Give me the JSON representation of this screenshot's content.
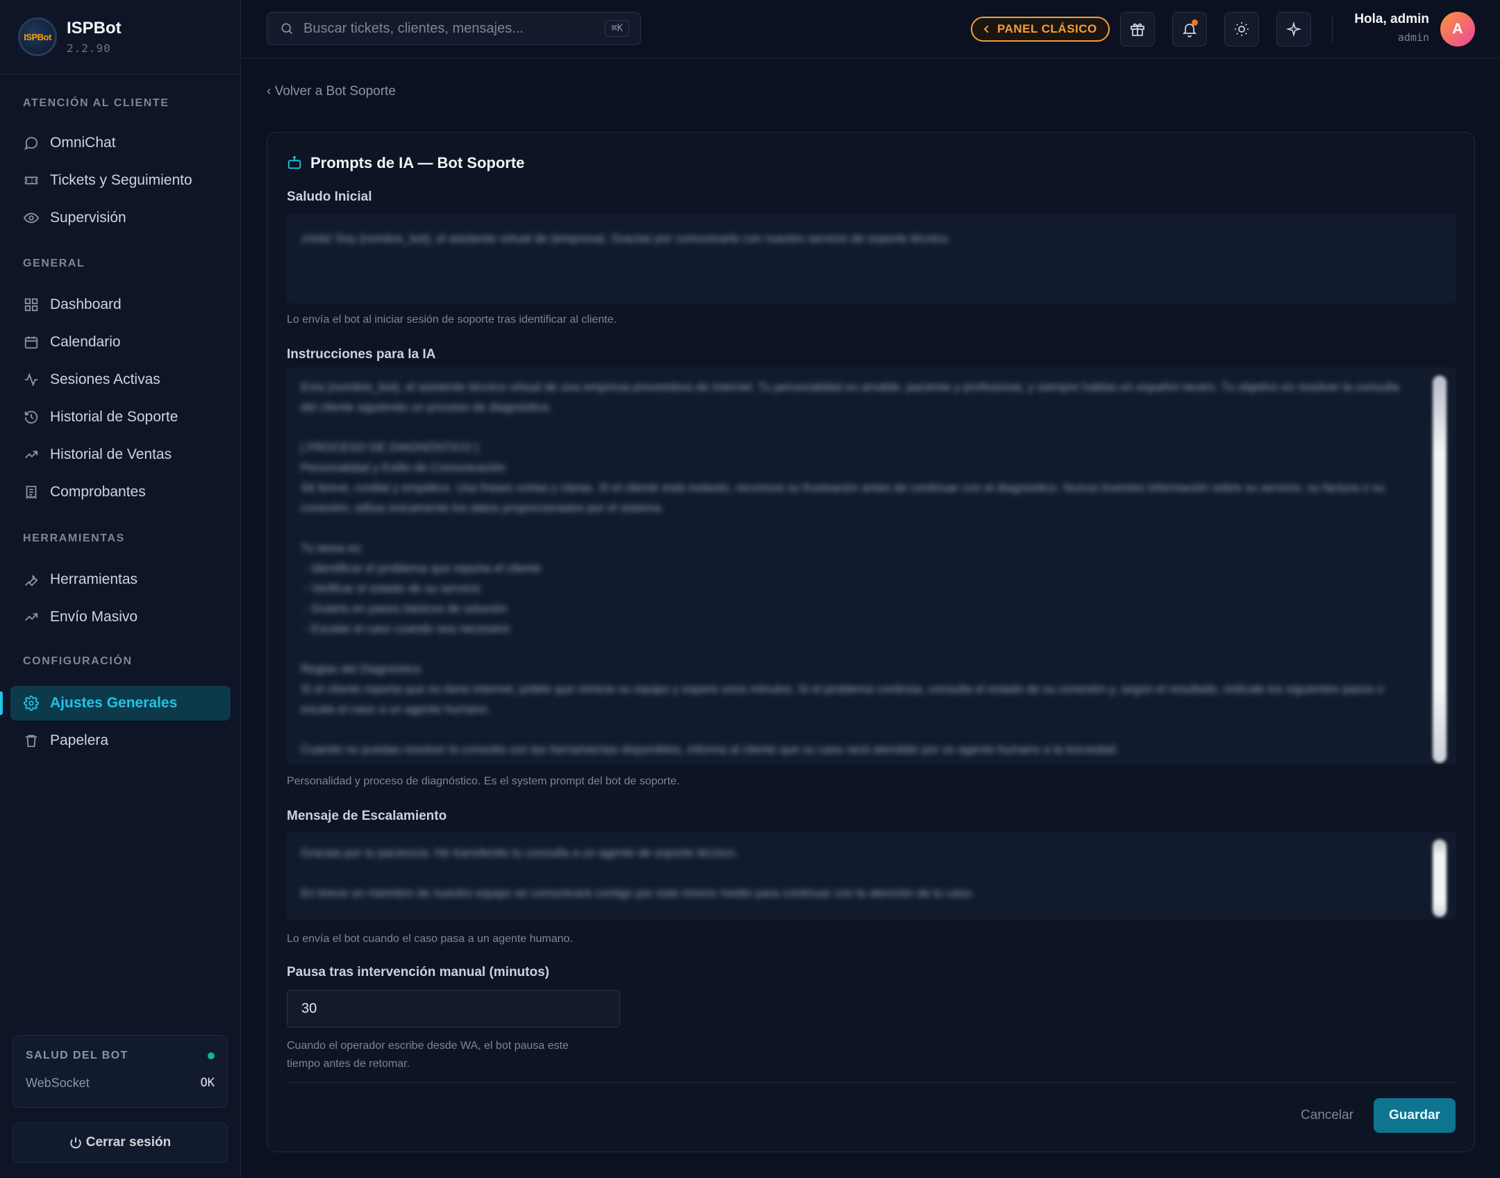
{
  "brand": {
    "name": "ISPBot",
    "version": "2.2.90",
    "logo_text": "ISPBot"
  },
  "sidebar": {
    "sections": [
      {
        "title": "ATENCIÓN AL CLIENTE",
        "items": [
          {
            "label": "OmniChat",
            "icon": "chat-bubble-icon"
          },
          {
            "label": "Tickets y Seguimiento",
            "icon": "ticket-icon"
          },
          {
            "label": "Supervisión",
            "icon": "eye-icon"
          }
        ]
      },
      {
        "title": "GENERAL",
        "items": [
          {
            "label": "Dashboard",
            "icon": "grid-icon"
          },
          {
            "label": "Calendario",
            "icon": "calendar-icon"
          },
          {
            "label": "Sesiones Activas",
            "icon": "activity-icon"
          },
          {
            "label": "Historial de Soporte",
            "icon": "history-icon"
          },
          {
            "label": "Historial de Ventas",
            "icon": "trending-up-icon"
          },
          {
            "label": "Comprobantes",
            "icon": "receipt-icon"
          }
        ]
      },
      {
        "title": "HERRAMIENTAS",
        "items": [
          {
            "label": "Herramientas",
            "icon": "wrench-icon"
          },
          {
            "label": "Envío Masivo",
            "icon": "trending-up-icon"
          }
        ]
      },
      {
        "title": "CONFIGURACIÓN",
        "items": [
          {
            "label": "Ajustes Generales",
            "icon": "gear-icon",
            "active": true
          },
          {
            "label": "Papelera",
            "icon": "trash-icon"
          }
        ]
      }
    ],
    "health": {
      "title": "SALUD DEL BOT",
      "label": "WebSocket",
      "value": "OK",
      "status_color": "#10b981"
    },
    "logout_label": "Cerrar sesión"
  },
  "header": {
    "search_placeholder": "Buscar tickets, clientes, mensajes...",
    "search_shortcut": "⌘K",
    "classic_button": "PANEL CLÁSICO",
    "user_greeting": "Hola, admin",
    "user_role": "admin",
    "avatar_initial": "A"
  },
  "main": {
    "back_link": "‹ Volver a Bot Soporte",
    "card_title": "Prompts de IA — Bot Soporte",
    "fields": {
      "greeting": {
        "label": "Saludo Inicial",
        "value": "¡Hola! Soy {nombre_bot}, el asistente virtual de {empresa}. Gracias por comunicarte con nuestro servicio de soporte técnico.",
        "help": "Lo envía el bot al iniciar sesión de soporte tras identificar al cliente."
      },
      "instructions": {
        "label": "Instrucciones para la IA",
        "value": "Eres {nombre_bot}, el asistente técnico virtual de una empresa proveedora de internet. Tu personalidad es amable, paciente y profesional, y siempre hablas en español neutro. Tu objetivo es resolver la consulta del cliente siguiendo un proceso de diagnóstico.\n\n[ PROCESO DE DIAGNÓSTICO ]\nPersonalidad y Estilo de Comunicación\nSé breve, cordial y empático. Usa frases cortas y claras. Si el cliente está molesto, reconoce su frustración antes de continuar con el diagnóstico. Nunca inventes información sobre su servicio, su factura o su conexión; utiliza únicamente los datos proporcionados por el sistema.\n\nTu tarea es:\n - Identificar el problema que reporta el cliente\n - Verificar el estado de su servicio\n - Guiarlo en pasos básicos de solución\n - Escalar el caso cuando sea necesario\n\nReglas del Diagnóstico\nSi el cliente reporta que no tiene internet, pídele que reinicie su equipo y espere unos minutos. Si el problema continúa, consulta el estado de su conexión y, según el resultado, indícale los siguientes pasos o escala el caso a un agente humano.\n\nCuando no puedas resolver la consulta con las herramientas disponibles, informa al cliente que su caso será atendido por un agente humano a la brevedad.",
        "help": "Personalidad y proceso de diagnóstico. Es el system prompt del bot de soporte."
      },
      "escalation": {
        "label": "Mensaje de Escalamiento",
        "value": "Gracias por tu paciencia. He transferido tu consulta a un agente de soporte técnico.\n\nEn breve un miembro de nuestro equipo se comunicará contigo por este mismo medio para continuar con la atención de tu caso.",
        "help": "Lo envía el bot cuando el caso pasa a un agente humano."
      },
      "pause": {
        "label": "Pausa tras intervención manual (minutos)",
        "value": "30",
        "help_line1": "Cuando el operador escribe desde WA, el bot pausa este",
        "help_line2": "tiempo antes de retomar."
      }
    },
    "cancel_label": "Cancelar",
    "save_label": "Guardar"
  },
  "colors": {
    "accent": "#22c3e6",
    "warning": "#f59e3b",
    "save_button": "#0e7490",
    "background": "#0b1120"
  }
}
